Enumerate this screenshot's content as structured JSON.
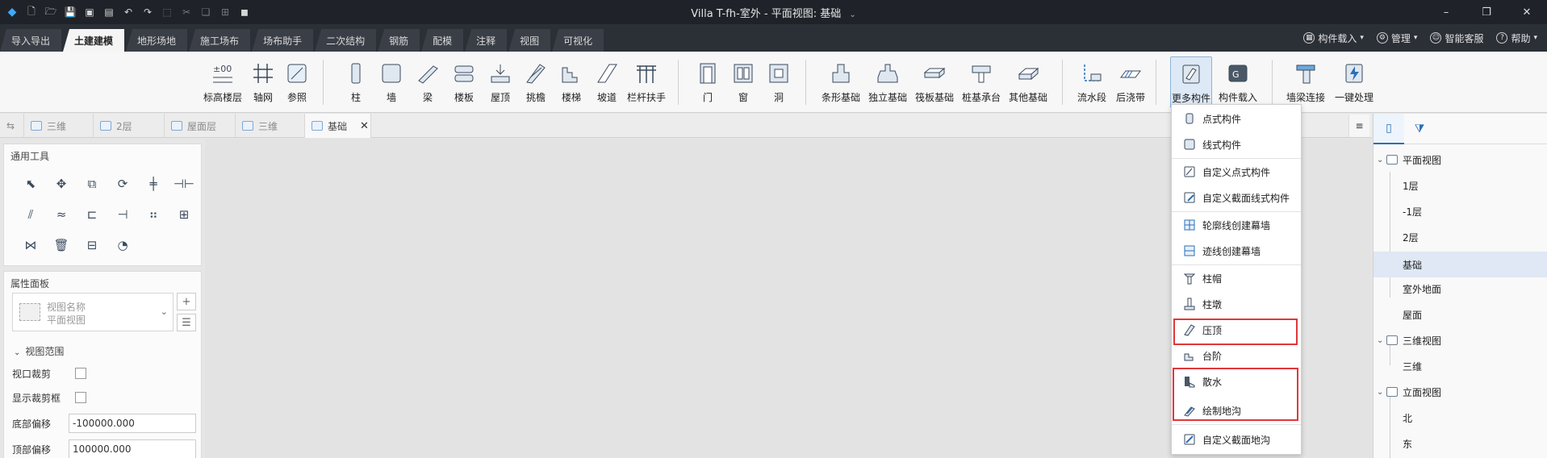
{
  "title": {
    "text": "Villa T-fh-室外 - 平面视图: 基础"
  },
  "window_controls": {
    "minimize": "–",
    "restore": "❐",
    "close": "✕"
  },
  "main_tabs": [
    {
      "label": "导入导出",
      "active": false
    },
    {
      "label": "土建建模",
      "active": true
    },
    {
      "label": "地形场地",
      "active": false
    },
    {
      "label": "施工场布",
      "active": false
    },
    {
      "label": "场布助手",
      "active": false
    },
    {
      "label": "二次结构",
      "active": false
    },
    {
      "label": "钢筋",
      "active": false
    },
    {
      "label": "配模",
      "active": false
    },
    {
      "label": "注释",
      "active": false
    },
    {
      "label": "视图",
      "active": false
    },
    {
      "label": "可视化",
      "active": false
    }
  ],
  "tab_right": {
    "component_load": "构件载入",
    "manage": "管理",
    "service": "智能客服",
    "help": "帮助"
  },
  "ribbon": [
    {
      "label": "标高楼层",
      "icon": "level-icon"
    },
    {
      "label": "轴网",
      "icon": "grid-icon"
    },
    {
      "label": "参照",
      "icon": "reference-icon"
    },
    {
      "label": "柱",
      "icon": "column-icon"
    },
    {
      "label": "墙",
      "icon": "wall-icon"
    },
    {
      "label": "梁",
      "icon": "beam-icon"
    },
    {
      "label": "楼板",
      "icon": "slab-icon"
    },
    {
      "label": "屋顶",
      "icon": "roof-icon"
    },
    {
      "label": "挑檐",
      "icon": "eave-icon"
    },
    {
      "label": "楼梯",
      "icon": "stair-icon"
    },
    {
      "label": "坡道",
      "icon": "ramp-icon"
    },
    {
      "label": "栏杆扶手",
      "icon": "railing-icon"
    },
    {
      "label": "门",
      "icon": "door-icon"
    },
    {
      "label": "窗",
      "icon": "window-icon"
    },
    {
      "label": "洞",
      "icon": "opening-icon"
    },
    {
      "label": "条形基础",
      "icon": "strip-foundation-icon"
    },
    {
      "label": "独立基础",
      "icon": "isolated-foundation-icon"
    },
    {
      "label": "筏板基础",
      "icon": "raft-foundation-icon"
    },
    {
      "label": "桩基承台",
      "icon": "pile-cap-icon"
    },
    {
      "label": "其他基础",
      "icon": "other-foundation-icon"
    },
    {
      "label": "流水段",
      "icon": "flow-section-icon"
    },
    {
      "label": "后浇带",
      "icon": "post-pour-strip-icon"
    },
    {
      "label": "更多构件",
      "icon": "more-components-icon"
    },
    {
      "label": "构件载入",
      "icon": "component-load-icon"
    },
    {
      "label": "墙梁连接",
      "icon": "wall-beam-join-icon"
    },
    {
      "label": "一键处理",
      "icon": "one-click-process-icon"
    }
  ],
  "view_tabs": [
    {
      "label": "三维",
      "active": false
    },
    {
      "label": "2层",
      "active": false
    },
    {
      "label": "屋面层",
      "active": false
    },
    {
      "label": "三维",
      "active": false
    },
    {
      "label": "基础",
      "active": true
    }
  ],
  "tool_panel": {
    "title": "通用工具"
  },
  "properties": {
    "title": "属性面板",
    "view_name_label": "视图名称",
    "view_type": "平面视图",
    "section": "视图范围",
    "rows": [
      {
        "label": "视口裁剪"
      },
      {
        "label": "显示裁剪框"
      }
    ],
    "bottom_offset_label": "底部偏移",
    "bottom_offset_value": "-100000.000",
    "top_offset_label": "顶部偏移",
    "top_offset_value": "100000.000"
  },
  "dropdown": {
    "items": [
      "点式构件",
      "线式构件",
      "自定义点式构件",
      "自定义截面线式构件",
      "轮廓线创建幕墙",
      "迹线创建幕墙",
      "柱帽",
      "柱墩",
      "压顶",
      "台阶",
      "散水",
      "绘制地沟",
      "自定义截面地沟"
    ],
    "highlighted": [
      "压顶",
      "散水",
      "绘制地沟"
    ]
  },
  "project_tree": {
    "groups": [
      {
        "label": "平面视图",
        "children": [
          "1层",
          "-1层",
          "2层",
          "基础",
          "室外地面",
          "屋面"
        ]
      },
      {
        "label": "三维视图",
        "children": [
          "三维"
        ]
      },
      {
        "label": "立面视图",
        "children": [
          "北",
          "东"
        ]
      }
    ],
    "selected": "基础"
  },
  "colors": {
    "titlebar": "#1f2329",
    "accent": "#2a6fb8",
    "highlight_box": "#e0373a"
  }
}
